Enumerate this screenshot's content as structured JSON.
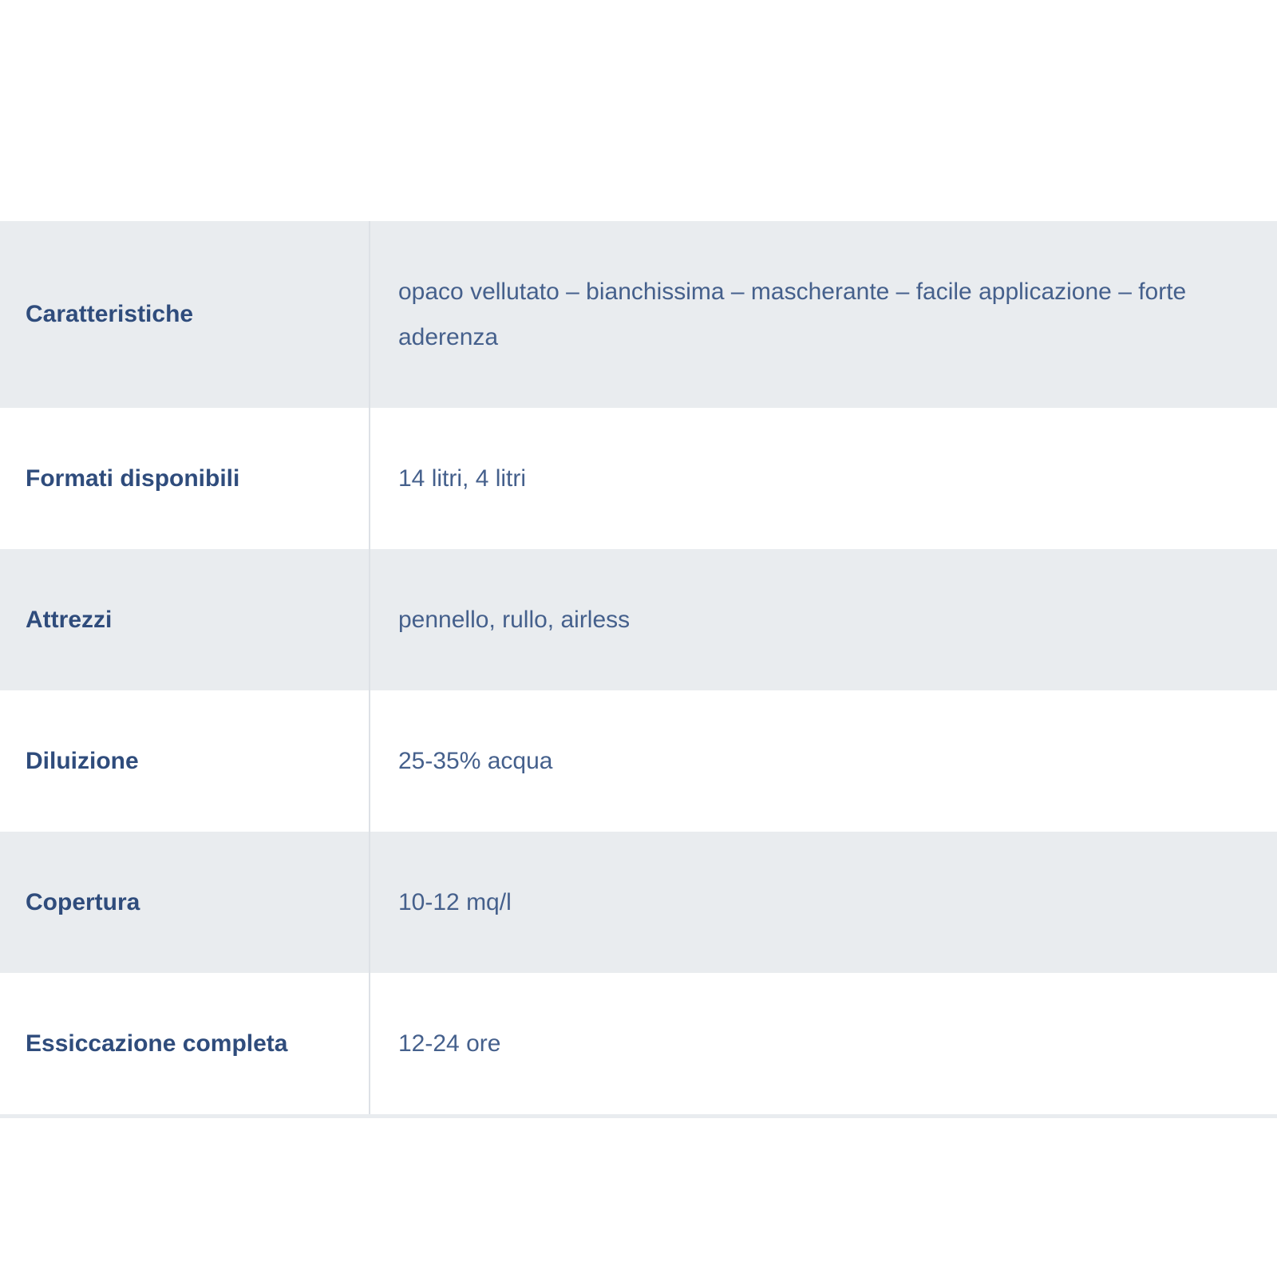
{
  "specs": {
    "rows": [
      {
        "label": "Caratteristiche",
        "value": "opaco vellutato – bianchissima – mascherante – facile applicazione – forte aderenza"
      },
      {
        "label": "Formati disponibili",
        "value": "14 litri, 4 litri"
      },
      {
        "label": "Attrezzi",
        "value": "pennello, rullo, airless"
      },
      {
        "label": "Diluizione",
        "value": "25-35% acqua"
      },
      {
        "label": "Copertura",
        "value": "10-12 mq/l"
      },
      {
        "label": "Essiccazione completa",
        "value": "12-24 ore"
      }
    ]
  },
  "colors": {
    "label_text": "#2f4c7c",
    "value_text": "#45608c",
    "shaded_row": "#e9ecef",
    "plain_row": "#ffffff",
    "divider": "#dde1e6"
  }
}
